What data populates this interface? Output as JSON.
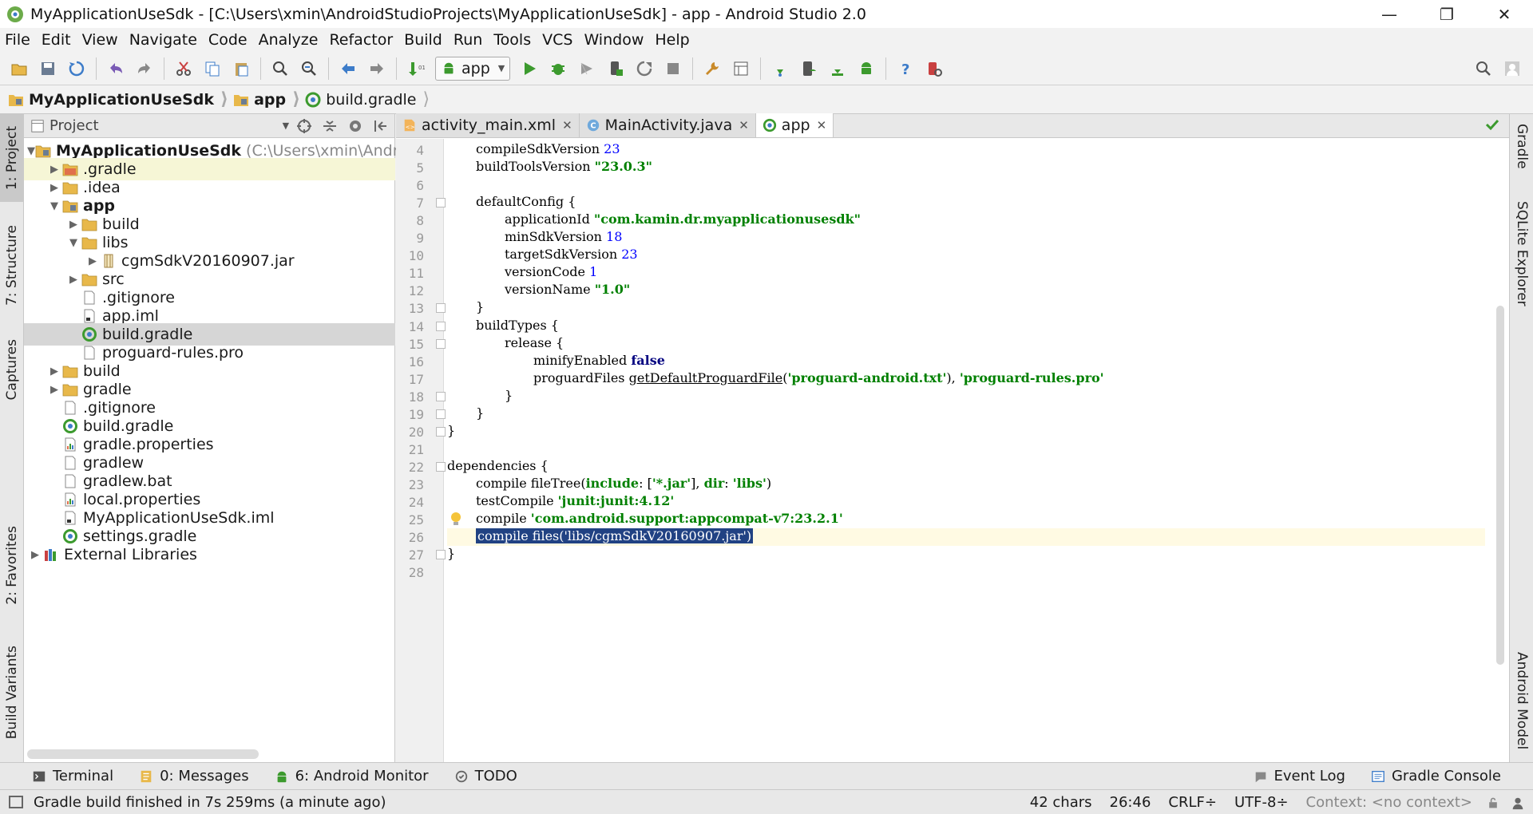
{
  "window": {
    "title": "MyApplicationUseSdk - [C:\\Users\\xmin\\AndroidStudioProjects\\MyApplicationUseSdk] - app - Android Studio 2.0",
    "minimize": "—",
    "restore": "❐",
    "close": "✕"
  },
  "menu": [
    "File",
    "Edit",
    "View",
    "Navigate",
    "Code",
    "Analyze",
    "Refactor",
    "Build",
    "Run",
    "Tools",
    "VCS",
    "Window",
    "Help"
  ],
  "toolbar": {
    "run_config": "app",
    "accent_green": "#3c9a2e",
    "accent_blue": "#3d7cc9"
  },
  "breadcrumb": [
    "MyApplicationUseSdk",
    "app",
    "build.gradle"
  ],
  "left_tabs": [
    "1: Project",
    "7: Structure",
    "Captures",
    "2: Favorites",
    "Build Variants"
  ],
  "right_tabs": [
    "Gradle",
    "SQLite Explorer",
    "Android Model"
  ],
  "project_panel": {
    "title": "Project",
    "tree": [
      {
        "depth": 0,
        "arrow": "▼",
        "icon": "module-folder-icon",
        "name": "MyApplicationUseSdk",
        "hint": "(C:\\Users\\xmin\\Android",
        "bold": true
      },
      {
        "depth": 1,
        "arrow": "▶",
        "icon": "folder-red-icon",
        "name": ".gradle",
        "highlight": true
      },
      {
        "depth": 1,
        "arrow": "▶",
        "icon": "folder-icon",
        "name": ".idea"
      },
      {
        "depth": 1,
        "arrow": "▼",
        "icon": "module-folder-icon",
        "name": "app",
        "bold": true
      },
      {
        "depth": 2,
        "arrow": "▶",
        "icon": "folder-icon",
        "name": "build"
      },
      {
        "depth": 2,
        "arrow": "▼",
        "icon": "folder-icon",
        "name": "libs"
      },
      {
        "depth": 3,
        "arrow": "▶",
        "icon": "jar-icon",
        "name": "cgmSdkV20160907.jar"
      },
      {
        "depth": 2,
        "arrow": "▶",
        "icon": "folder-icon",
        "name": "src"
      },
      {
        "depth": 2,
        "arrow": "",
        "icon": "file-icon",
        "name": ".gitignore"
      },
      {
        "depth": 2,
        "arrow": "",
        "icon": "iml-file-icon",
        "name": "app.iml"
      },
      {
        "depth": 2,
        "arrow": "",
        "icon": "gradle-icon",
        "name": "build.gradle",
        "selected": true
      },
      {
        "depth": 2,
        "arrow": "",
        "icon": "file-icon",
        "name": "proguard-rules.pro"
      },
      {
        "depth": 1,
        "arrow": "▶",
        "icon": "folder-icon",
        "name": "build"
      },
      {
        "depth": 1,
        "arrow": "▶",
        "icon": "folder-icon",
        "name": "gradle"
      },
      {
        "depth": 1,
        "arrow": "",
        "icon": "file-icon",
        "name": ".gitignore"
      },
      {
        "depth": 1,
        "arrow": "",
        "icon": "gradle-icon",
        "name": "build.gradle"
      },
      {
        "depth": 1,
        "arrow": "",
        "icon": "properties-icon",
        "name": "gradle.properties"
      },
      {
        "depth": 1,
        "arrow": "",
        "icon": "file-icon",
        "name": "gradlew"
      },
      {
        "depth": 1,
        "arrow": "",
        "icon": "file-icon",
        "name": "gradlew.bat"
      },
      {
        "depth": 1,
        "arrow": "",
        "icon": "properties-icon",
        "name": "local.properties"
      },
      {
        "depth": 1,
        "arrow": "",
        "icon": "iml-file-icon",
        "name": "MyApplicationUseSdk.iml"
      },
      {
        "depth": 1,
        "arrow": "",
        "icon": "gradle-icon",
        "name": "settings.gradle"
      },
      {
        "depth": 0,
        "arrow": "▶",
        "icon": "library-icon",
        "name": "External Libraries"
      }
    ]
  },
  "editor": {
    "tabs": [
      {
        "label": "activity_main.xml",
        "icon": "xml-file-icon",
        "active": false
      },
      {
        "label": "MainActivity.java",
        "icon": "java-class-icon",
        "active": false
      },
      {
        "label": "app",
        "icon": "gradle-icon",
        "active": true
      }
    ],
    "current_line": 26,
    "lines": [
      {
        "n": 4,
        "indent": 1,
        "tokens": [
          [
            "t",
            "compileSdkVersion "
          ],
          [
            "num",
            "23"
          ]
        ]
      },
      {
        "n": 5,
        "indent": 1,
        "tokens": [
          [
            "t",
            "buildToolsVersion "
          ],
          [
            "str",
            "\"23.0.3\""
          ]
        ]
      },
      {
        "n": 6,
        "indent": 0,
        "tokens": []
      },
      {
        "n": 7,
        "indent": 1,
        "fold": true,
        "tokens": [
          [
            "t",
            "defaultConfig {"
          ]
        ]
      },
      {
        "n": 8,
        "indent": 2,
        "tokens": [
          [
            "t",
            "applicationId "
          ],
          [
            "str",
            "\"com.kamin.dr.myapplicationusesdk\""
          ]
        ]
      },
      {
        "n": 9,
        "indent": 2,
        "tokens": [
          [
            "t",
            "minSdkVersion "
          ],
          [
            "num",
            "18"
          ]
        ]
      },
      {
        "n": 10,
        "indent": 2,
        "tokens": [
          [
            "t",
            "targetSdkVersion "
          ],
          [
            "num",
            "23"
          ]
        ]
      },
      {
        "n": 11,
        "indent": 2,
        "tokens": [
          [
            "t",
            "versionCode "
          ],
          [
            "num",
            "1"
          ]
        ]
      },
      {
        "n": 12,
        "indent": 2,
        "tokens": [
          [
            "t",
            "versionName "
          ],
          [
            "str",
            "\"1.0\""
          ]
        ]
      },
      {
        "n": 13,
        "indent": 1,
        "fold": true,
        "tokens": [
          [
            "t",
            "}"
          ]
        ]
      },
      {
        "n": 14,
        "indent": 1,
        "fold": true,
        "tokens": [
          [
            "t",
            "buildTypes {"
          ]
        ]
      },
      {
        "n": 15,
        "indent": 2,
        "fold": true,
        "tokens": [
          [
            "t",
            "release {"
          ]
        ]
      },
      {
        "n": 16,
        "indent": 3,
        "tokens": [
          [
            "t",
            "minifyEnabled "
          ],
          [
            "kw",
            "false"
          ]
        ]
      },
      {
        "n": 17,
        "indent": 3,
        "tokens": [
          [
            "t",
            "proguardFiles "
          ],
          [
            "und",
            "getDefaultProguardFile"
          ],
          [
            "t",
            "("
          ],
          [
            "str",
            "'proguard-android.txt'"
          ],
          [
            "t",
            "), "
          ],
          [
            "str",
            "'proguard-rules.pro'"
          ]
        ]
      },
      {
        "n": 18,
        "indent": 2,
        "fold": true,
        "tokens": [
          [
            "t",
            "}"
          ]
        ]
      },
      {
        "n": 19,
        "indent": 1,
        "fold": true,
        "tokens": [
          [
            "t",
            "}"
          ]
        ]
      },
      {
        "n": 20,
        "indent": 0,
        "fold": true,
        "tokens": [
          [
            "t",
            "}"
          ]
        ]
      },
      {
        "n": 21,
        "indent": 0,
        "tokens": []
      },
      {
        "n": 22,
        "indent": 0,
        "fold": true,
        "tokens": [
          [
            "t",
            "dependencies {"
          ]
        ]
      },
      {
        "n": 23,
        "indent": 1,
        "tokens": [
          [
            "t",
            "compile fileTree("
          ],
          [
            "str",
            "include"
          ],
          [
            "t",
            ": ["
          ],
          [
            "str",
            "'*.jar'"
          ],
          [
            "t",
            "], "
          ],
          [
            "str",
            "dir"
          ],
          [
            "t",
            ": "
          ],
          [
            "str",
            "'libs'"
          ],
          [
            "t",
            ")"
          ]
        ]
      },
      {
        "n": 24,
        "indent": 1,
        "tokens": [
          [
            "t",
            "testCompile "
          ],
          [
            "str",
            "'junit:junit:4.12'"
          ]
        ]
      },
      {
        "n": 25,
        "indent": 1,
        "bulb": true,
        "tokens": [
          [
            "t",
            "compile "
          ],
          [
            "str",
            "'com.android.support:appcompat-v7:23.2.1'"
          ]
        ]
      },
      {
        "n": 26,
        "indent": 1,
        "tokens": [
          [
            "sel",
            "compile files('libs/cgmSdkV20160907.jar')"
          ]
        ]
      },
      {
        "n": 27,
        "indent": 0,
        "fold": true,
        "tokens": [
          [
            "t",
            "}"
          ]
        ]
      },
      {
        "n": 28,
        "indent": 0,
        "tokens": []
      }
    ]
  },
  "bottom_tabs": {
    "left": [
      {
        "label": "Terminal",
        "icon": "terminal-icon"
      },
      {
        "label": "0: Messages",
        "icon": "messages-icon"
      },
      {
        "label": "6: Android Monitor",
        "icon": "android-icon"
      },
      {
        "label": "TODO",
        "icon": "todo-icon"
      }
    ],
    "right": [
      {
        "label": "Event Log",
        "icon": "event-log-icon"
      },
      {
        "label": "Gradle Console",
        "icon": "gradle-console-icon"
      }
    ]
  },
  "status": {
    "message": "Gradle build finished in 7s 259ms (a minute ago)",
    "chars": "42 chars",
    "position": "26:46",
    "line_sep": "CRLF",
    "encoding": "UTF-8",
    "context": "Context: <no context>"
  }
}
